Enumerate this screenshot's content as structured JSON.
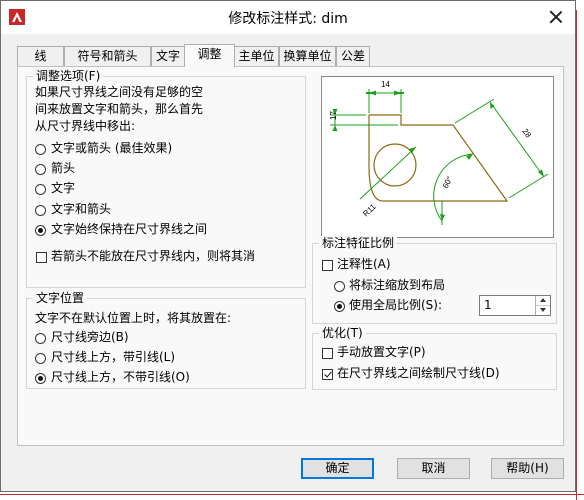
{
  "window": {
    "title": "修改标注样式: dim"
  },
  "tabs": [
    {
      "label": "线",
      "active": false
    },
    {
      "label": "符号和箭头",
      "active": false
    },
    {
      "label": "文字",
      "active": false
    },
    {
      "label": "调整",
      "active": true
    },
    {
      "label": "主单位",
      "active": false
    },
    {
      "label": "换算单位",
      "active": false
    },
    {
      "label": "公差",
      "active": false
    }
  ],
  "fit_options": {
    "title": "调整选项(F)",
    "description_lines": [
      "如果尺寸界线之间没有足够的空",
      "间来放置文字和箭头，那么首先",
      "从尺寸界线中移出:"
    ],
    "options": [
      {
        "label": "文字或箭头 (最佳效果)",
        "selected": false
      },
      {
        "label": "箭头",
        "selected": false
      },
      {
        "label": "文字",
        "selected": false
      },
      {
        "label": "文字和箭头",
        "selected": false
      },
      {
        "label": "文字始终保持在尺寸界线之间",
        "selected": true
      }
    ],
    "suppress_arrows": {
      "label": "若箭头不能放在尺寸界线内，则将其消",
      "checked": false
    }
  },
  "text_placement": {
    "title": "文字位置",
    "description": "文字不在默认位置上时，将其放置在:",
    "options": [
      {
        "label": "尺寸线旁边(B)",
        "selected": false
      },
      {
        "label": "尺寸线上方，带引线(L)",
        "selected": false
      },
      {
        "label": "尺寸线上方，不带引线(O)",
        "selected": true
      }
    ]
  },
  "preview": {
    "labels": {
      "top": "14",
      "left": "17",
      "diag": "28",
      "angle": "60°",
      "radius": "R11"
    },
    "colors": {
      "geometry": "#8b6914",
      "dimension": "#1aa01a"
    }
  },
  "scale": {
    "title": "标注特征比例",
    "annotative": {
      "label": "注释性(A)",
      "checked": false
    },
    "scale_to_layout": {
      "label": "将标注缩放到布局",
      "selected": false
    },
    "use_overall": {
      "label": "使用全局比例(S):",
      "selected": true
    },
    "overall_value": "1"
  },
  "fine_tuning": {
    "title": "优化(T)",
    "manual_place": {
      "label": "手动放置文字(P)",
      "checked": false
    },
    "draw_between": {
      "label": "在尺寸界线之间绘制尺寸线(D)",
      "checked": true
    }
  },
  "buttons": {
    "ok": "确定",
    "cancel": "取消",
    "help": "帮助(H)"
  }
}
